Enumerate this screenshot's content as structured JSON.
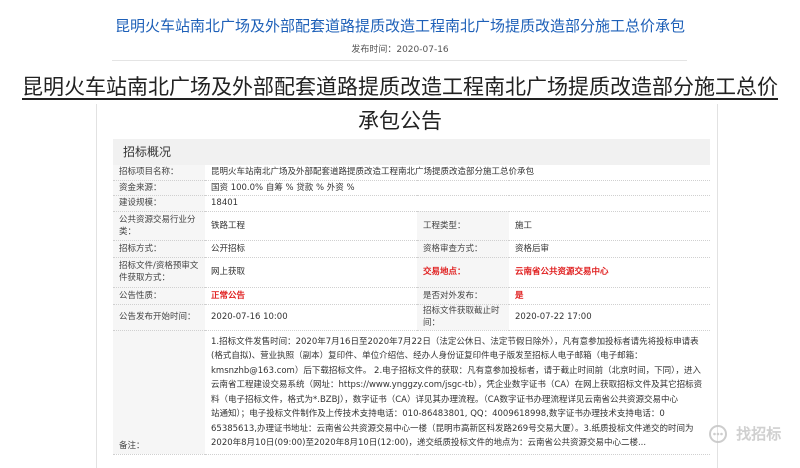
{
  "header": {
    "title": "昆明火车站南北广场及外部配套道路提质改造工程南北广场提质改造部分施工总价承包",
    "pub_time": "发布时间：2020-07-16"
  },
  "doc": {
    "title_line1": "昆明火车站南北广场及外部配套道路提质改造工程南北广场提质改造部分施工总价",
    "title_line2": "承包公告",
    "section_title": "招标概况"
  },
  "fields": {
    "project_name_label": "招标项目名称：",
    "project_name": "昆明火车站南北广场及外部配套道路提质改造工程南北广场提质改造部分施工总价承包",
    "fund_source_label": "资金来源：",
    "fund_source": "国资 100.0% 自筹 % 贷款 % 外资 %",
    "scale_label": "建设规模：",
    "scale": "18401",
    "industry_label": "公共资源交易行业分类：",
    "industry": "铁路工程",
    "project_type_label": "工程类型：",
    "project_type": "施工",
    "bid_method_label": "招标方式：",
    "bid_method": "公开招标",
    "review_method_label": "资格审查方式：",
    "review_method": "资格后审",
    "doc_get_label": "招标文件/资格预审文件获取方式：",
    "doc_get": "网上获取",
    "venue_label": "交易地点：",
    "venue": "云南省公共资源交易中心",
    "nature_label": "公告性质：",
    "nature": "正常公告",
    "external_label": "是否对外发布：",
    "external": "是",
    "start_time_label": "公告发布开始时间：",
    "start_time": "2020-07-16 10:00",
    "deadline_label": "招标文件获取截止时间：",
    "deadline": "2020-07-22 17:00",
    "note_label": "备注："
  },
  "notes": [
    "1.招标文件发售时间：2020年7月16日至2020年7月22日（法定公休日、法定节假日除外），凡有意参加投标者请先将投标申请表",
    "(格式自拟)、营业执照（副本）复印件、单位介绍信、经办人身份证复印件电子版发至招标人电子邮箱（电子邮箱：",
    "kmsnzhb@163.com）后下载招标文件。 2.电子招标文件的获取：凡有意参加投标者，请于截止时间前（北京时间，下同），进入",
    "云南省工程建设交易系统（网址：https://www.ynggzy.com/jsgc-tb），凭企业数字证书（CA）在网上获取招标文件及其它招标资",
    "料（电子招标文件，格式为*.BZBJ），数字证书（CA）详见其办理流程。（CA数字证书办理流程详见云南省公共资源交易中心",
    "站通知）；电子投标文件制作及上传技术支持电话：010-86483801, QQ：4009618998,数字证书办理技术支持电话：0",
    "65385613,办理证书地址：云南省公共资源交易中心一楼（昆明市高新区科发路269号交易大厦）。3.纸质投标文件递交的时间为",
    "2020年8月10日(09:00)至2020年8月10日(12:00)，递交纸质投标文件的地点为：云南省公共资源交易中心二楼..."
  ],
  "watermark": {
    "text": "找招标",
    "icon": "chat-bubble-icon"
  },
  "colors": {
    "title_blue": "#1e60b8",
    "highlight_red": "#e02020"
  }
}
